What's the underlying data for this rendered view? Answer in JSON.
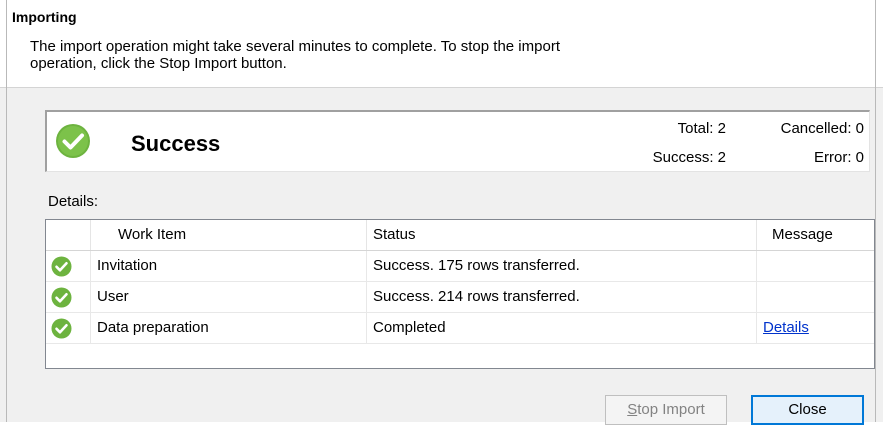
{
  "header": {
    "title": "Importing",
    "description_line1": "The import operation might take several minutes to complete. To stop the import",
    "description_line2": "operation, click the Stop Import button."
  },
  "summary": {
    "status_title": "Success",
    "total_label": "Total: 2",
    "cancelled_label": "Cancelled: 0",
    "success_label": "Success: 2",
    "error_label": "Error: 0"
  },
  "details": {
    "label": "Details:",
    "columns": [
      "Work Item",
      "Status",
      "Message"
    ],
    "rows": [
      {
        "work_item": "Invitation",
        "status": "Success. 175 rows transferred.",
        "message": ""
      },
      {
        "work_item": "User",
        "status": "Success. 214 rows transferred.",
        "message": ""
      },
      {
        "work_item": "Data preparation",
        "status": "Completed",
        "message": "Details"
      }
    ]
  },
  "buttons": {
    "stop_import_mnemonic": "S",
    "stop_import_rest": "top Import",
    "close": "Close"
  },
  "colors": {
    "success_green": "#6db33f",
    "link_blue": "#0033cc",
    "focus_blue": "#0078d7"
  },
  "icons": {
    "status": "check-circle-icon"
  }
}
